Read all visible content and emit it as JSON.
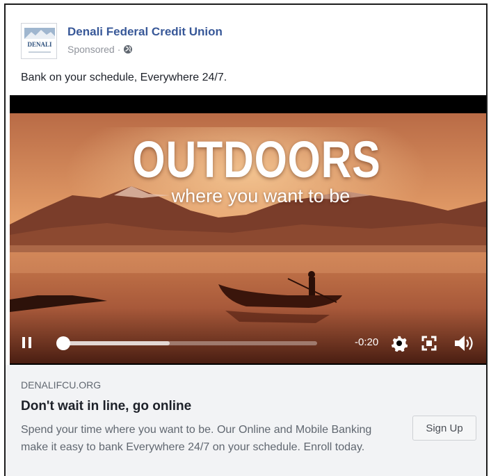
{
  "post": {
    "page_name": "Denali Federal Credit Union",
    "logo_text": "DENALI",
    "sponsored": "Sponsored",
    "separator": "·",
    "audience_icon": "globe-icon",
    "text": "Bank on your schedule, Everywhere 24/7."
  },
  "video": {
    "title": "OUTDOORS",
    "subtitle": "where you want to be",
    "time_remaining": "-0:20",
    "progress": 0.02,
    "buffered": 0.43,
    "icons": [
      "pause-icon",
      "gear-icon",
      "fullscreen-icon",
      "volume-icon"
    ]
  },
  "link": {
    "domain": "DENALIFCU.ORG",
    "headline": "Don't wait in line, go online",
    "description": "Spend your time where you want to be. Our Online and Mobile Banking make it easy to bank Everywhere 24/7 on your schedule. Enroll today.",
    "cta_label": "Sign Up"
  },
  "colors": {
    "link_blue": "#385898",
    "footer_bg": "#f2f3f5",
    "muted_text": "#606770",
    "sunset_orange": "#d9874f"
  }
}
